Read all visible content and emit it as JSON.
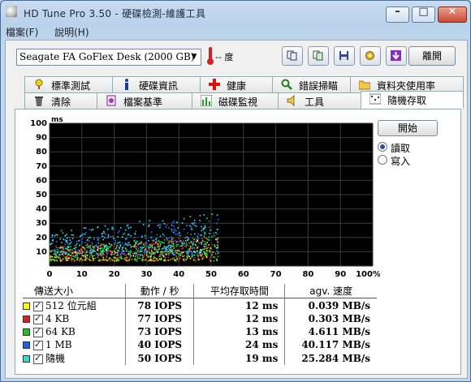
{
  "window": {
    "title": "HD Tune Pro 3.50 - 硬碟檢測-維護工具"
  },
  "menu": {
    "items": [
      "檔案(F)",
      "說明(H)"
    ]
  },
  "toolbar": {
    "drive": "Seagate FA GoFlex Desk (2000 GB)",
    "temperature": "-- 度",
    "exit_label": "離開",
    "buttons": [
      "copy-info-icon",
      "copy-screenshot-icon",
      "save-icon",
      "options-icon",
      "download-icon"
    ]
  },
  "tabs_row1": [
    {
      "label": "標準測試",
      "icon": "benchmark-icon"
    },
    {
      "label": "硬碟資訊",
      "icon": "info-icon"
    },
    {
      "label": "健康",
      "icon": "health-icon"
    },
    {
      "label": "錯誤掃瞄",
      "icon": "error-scan-icon"
    },
    {
      "label": "資料夾使用率",
      "icon": "folder-usage-icon"
    }
  ],
  "tabs_row2": [
    {
      "label": "清除",
      "icon": "erase-icon"
    },
    {
      "label": "檔案基準",
      "icon": "file-benchmark-icon"
    },
    {
      "label": "磁碟監視",
      "icon": "disk-monitor-icon"
    },
    {
      "label": "工具",
      "icon": "tools-icon"
    },
    {
      "label": "隨機存取",
      "icon": "random-access-icon",
      "active": true
    }
  ],
  "controls": {
    "start_label": "開始",
    "mode_options": [
      {
        "label": "讀取",
        "selected": true
      },
      {
        "label": "寫入",
        "selected": false
      }
    ]
  },
  "chart_data": {
    "type": "scatter",
    "ylabel": "ms",
    "xlim": [
      0,
      100
    ],
    "ylim": [
      0,
      100
    ],
    "x_ticks": [
      "0",
      "10",
      "20",
      "30",
      "40",
      "50",
      "60",
      "70",
      "80",
      "90",
      "100%"
    ],
    "y_ticks": [
      "10",
      "20",
      "30",
      "40",
      "50",
      "60",
      "70",
      "80",
      "90",
      "100"
    ],
    "grid": true,
    "background": "#000000",
    "series": [
      {
        "color": "#ffff00",
        "x_range": [
          0,
          52
        ],
        "y_range": [
          4,
          20
        ]
      },
      {
        "color": "#ff2020",
        "x_range": [
          0,
          52
        ],
        "y_range": [
          4,
          22
        ]
      },
      {
        "color": "#20e020",
        "x_range": [
          0,
          52
        ],
        "y_range": [
          4,
          22
        ]
      },
      {
        "color": "#3070ff",
        "x_range": [
          0,
          52
        ],
        "y_range": [
          8,
          36
        ]
      },
      {
        "color": "#20e8f0",
        "x_range": [
          0,
          52
        ],
        "y_range": [
          8,
          38
        ]
      }
    ]
  },
  "results": {
    "headers": [
      "傳送大小",
      "動作 / 秒",
      "平均存取時間",
      "agv. 速度"
    ],
    "rows": [
      {
        "color": "#ffff00",
        "name": "512 位元組",
        "ops": "78 IOPS",
        "access": "12 ms",
        "speed": "0.039 MB/s"
      },
      {
        "color": "#e02020",
        "name": "4 KB",
        "ops": "77 IOPS",
        "access": "12 ms",
        "speed": "0.303 MB/s"
      },
      {
        "color": "#20c020",
        "name": "64 KB",
        "ops": "73 IOPS",
        "access": "13 ms",
        "speed": "4.611 MB/s"
      },
      {
        "color": "#2060e0",
        "name": "1 MB",
        "ops": "40 IOPS",
        "access": "24 ms",
        "speed": "40.117 MB/s"
      },
      {
        "color": "#20e0e0",
        "name": "隨機",
        "ops": "50 IOPS",
        "access": "19 ms",
        "speed": "25.284 MB/s"
      }
    ]
  }
}
